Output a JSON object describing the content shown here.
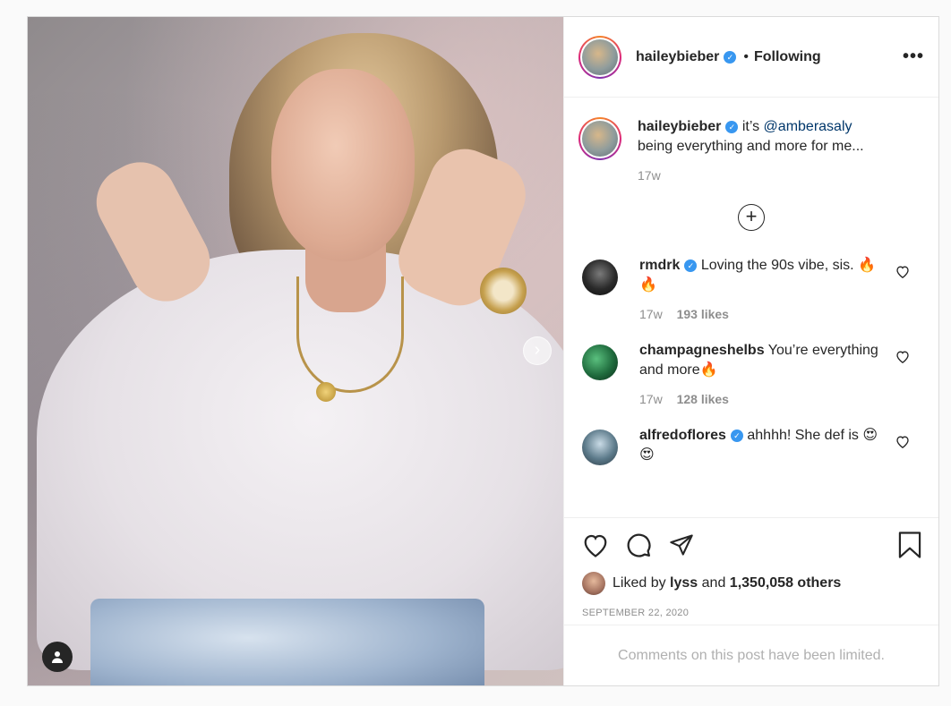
{
  "post": {
    "author": "haileybieber",
    "follow_separator": "•",
    "follow_status": "Following",
    "more_glyph": "•••",
    "caption": {
      "username": "haileybieber",
      "text_before": "it’s",
      "mention": "@amberasaly",
      "text_after": "being everything and more for me...",
      "time": "17w"
    },
    "load_more_glyph": "+",
    "comments": [
      {
        "username": "rmdrk",
        "verified": true,
        "text": "Loving the 90s vibe, sis. 🔥🔥",
        "time": "17w",
        "likes": "193 likes"
      },
      {
        "username": "champagneshelbs",
        "verified": false,
        "text": "You’re everything and more🔥",
        "time": "17w",
        "likes": "128 likes"
      },
      {
        "username": "alfredoflores",
        "verified": true,
        "text": "ahhhh! She def is 😍😍",
        "time": "",
        "likes": ""
      }
    ],
    "liked_by": {
      "prefix": "Liked by",
      "user": "lyss",
      "conjunction": "and",
      "others": "1,350,058 others"
    },
    "date": "SEPTEMBER 22, 2020",
    "comments_limited": "Comments on this post have been limited."
  },
  "media": {
    "next_glyph": "›"
  },
  "colors": {
    "accent": "#3897f0",
    "text": "#262626",
    "muted": "#8e8e8e",
    "mention": "#00376b"
  },
  "icons": [
    "user-tag-icon",
    "chevron-right-icon",
    "verified-icon",
    "more-icon",
    "plus-circle-icon",
    "heart-icon",
    "comment-icon",
    "share-icon",
    "bookmark-icon"
  ]
}
